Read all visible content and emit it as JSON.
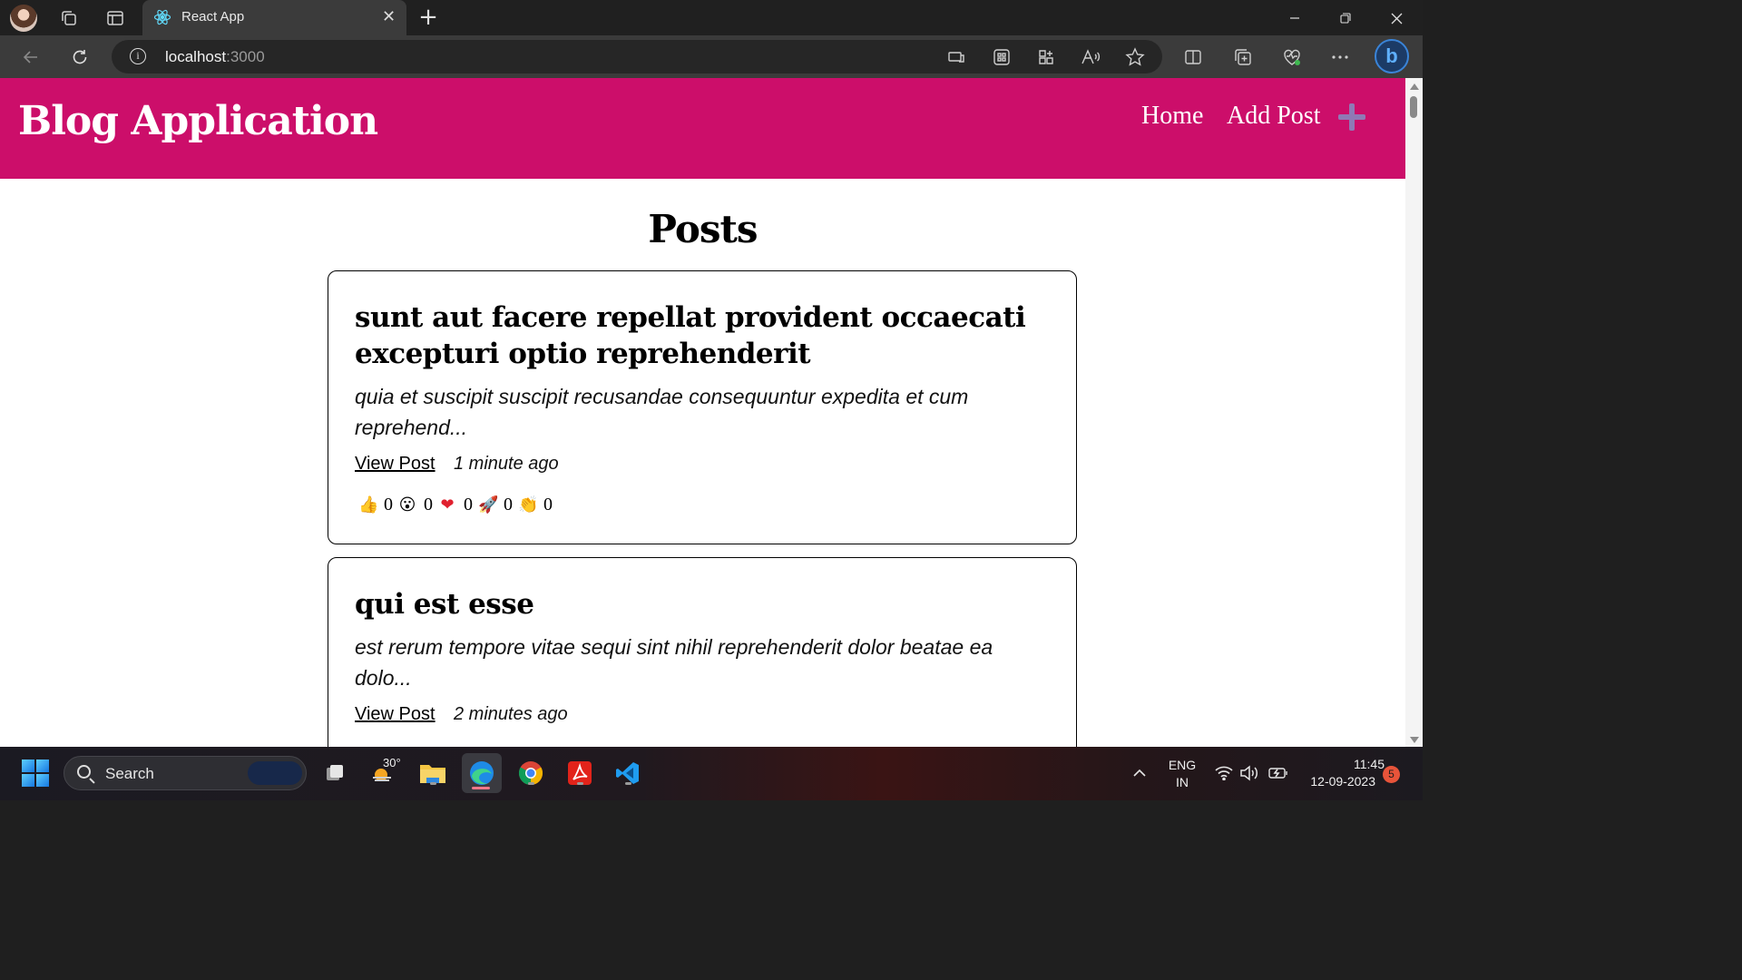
{
  "browser": {
    "tab_title": "React App",
    "url_host": "localhost",
    "url_port": ":3000",
    "new_tab_symbol": "+",
    "close_symbol": "✕"
  },
  "app": {
    "brand": "Blog Application",
    "nav": [
      {
        "label": "Home"
      },
      {
        "label": "Add Post"
      }
    ],
    "accent_color": "#cc0e6a"
  },
  "page": {
    "heading": "Posts",
    "posts": [
      {
        "title": "sunt aut facere repellat provident occaecati excepturi optio reprehenderit",
        "excerpt": "quia et suscipit suscipit recusandae consequuntur expedita et cum reprehend...",
        "link_label": "View Post",
        "time_ago": "1 minute ago",
        "reactions": [
          {
            "icon": "thumbs-up-icon",
            "emoji": "👍",
            "count": "0"
          },
          {
            "icon": "wow-icon",
            "emoji": "😮",
            "count": "0"
          },
          {
            "icon": "heart-icon",
            "emoji": "❤",
            "count": "0"
          },
          {
            "icon": "rocket-icon",
            "emoji": "🚀",
            "count": "0"
          },
          {
            "icon": "clap-icon",
            "emoji": "👏",
            "count": "0"
          }
        ]
      },
      {
        "title": "qui est esse",
        "excerpt": "est rerum tempore vitae sequi sint nihil reprehenderit dolor beatae ea dolo...",
        "link_label": "View Post",
        "time_ago": "2 minutes ago"
      }
    ]
  },
  "taskbar": {
    "search_placeholder": "Search",
    "weather_temp": "30°",
    "language": "ENG",
    "region": "IN",
    "time": "11:45",
    "date": "12-09-2023",
    "notification_count": "5"
  }
}
